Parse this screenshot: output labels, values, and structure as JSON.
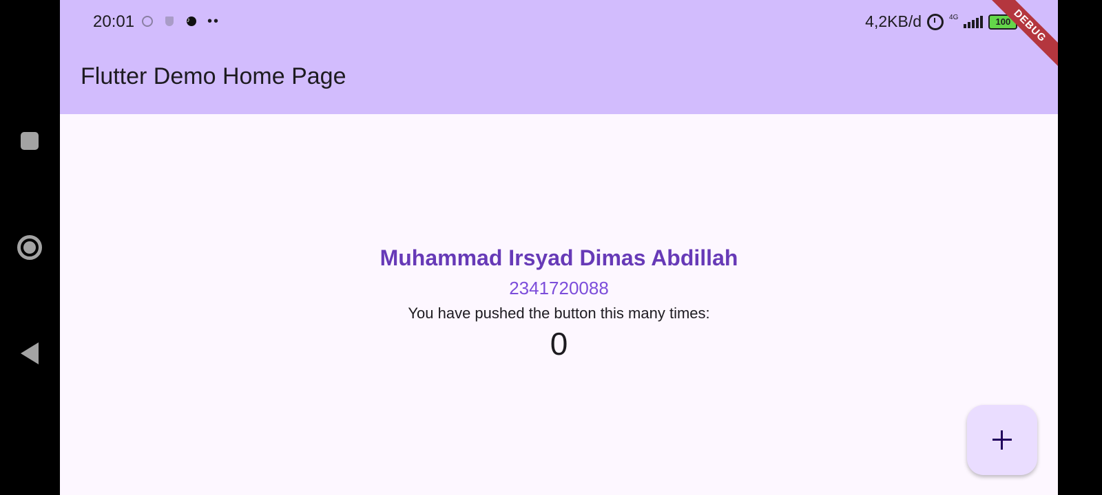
{
  "status_bar": {
    "time": "20:01",
    "left_icons": [
      "notification-ring-icon",
      "shield-icon",
      "tiktok-icon"
    ],
    "more_dots": "••",
    "network_speed": "4,2KB/d",
    "network_type": "4G",
    "battery_level": "100"
  },
  "debug_banner": {
    "label": "DEBUG"
  },
  "app_bar": {
    "title": "Flutter Demo Home Page"
  },
  "main": {
    "name": "Muhammad Irsyad Dimas Abdillah",
    "nim": "2341720088",
    "description": "You have pushed the button this many times:",
    "counter": "0"
  },
  "fab": {
    "icon": "plus-icon"
  },
  "nav_rail": {
    "buttons": [
      "recent-apps-icon",
      "home-icon",
      "back-icon"
    ]
  },
  "colors": {
    "app_bar": "#d2bcfd",
    "background": "#fdf7ff",
    "name_color": "#673ab7",
    "nim_color": "#7c4dda",
    "fab_background": "#eaddff",
    "debug_banner": "#b4363e"
  }
}
